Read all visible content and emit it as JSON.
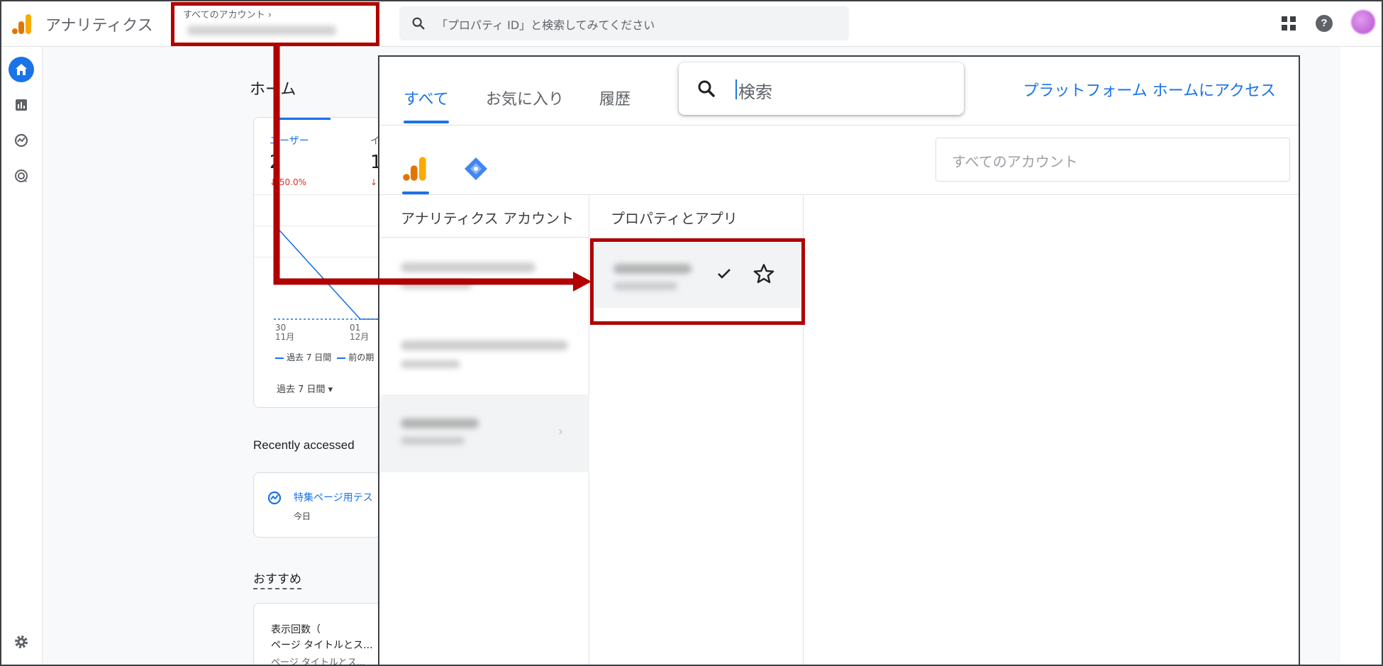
{
  "app": {
    "title": "アナリティクス",
    "account_picker_label": "すべてのアカウント",
    "account_picker_chevron": "›",
    "search_placeholder": "「プロパティ ID」と検索してみてください",
    "help_label": "?"
  },
  "icons": {
    "logo": "analytics-logo-icon",
    "search": "search-icon",
    "apps": "apps-grid-icon",
    "help": "help-icon",
    "home": "home-icon",
    "reports": "reports-icon",
    "explore": "explore-icon",
    "advertising": "advertising-icon",
    "settings": "gear-icon",
    "check": "check-icon",
    "star": "star-outline-icon"
  },
  "main": {
    "page_title": "ホーム",
    "metrics": [
      {
        "label": "ユーザー",
        "value": "2",
        "change": "↓ 50.0%"
      },
      {
        "label": "イ",
        "value": "1",
        "change": "↓"
      }
    ],
    "chart": {
      "x_ticks": [
        {
          "day": "30",
          "month": "11月"
        },
        {
          "day": "01",
          "month": "12月"
        }
      ],
      "legend_current": "過去 7 日間",
      "legend_previous": "前の期"
    },
    "date_range": "過去 7 日間 ▾",
    "recent_title": "Recently accessed",
    "recent_item": {
      "name": "特集ページ用テス",
      "date": "今日"
    },
    "reco_title": "おすすめ",
    "reco_card": {
      "line1": "表示回数（",
      "line2": "ページ タイトルとス...",
      "line3": "ページ タイトルとス..."
    }
  },
  "picker": {
    "tabs": [
      "すべて",
      "お気に入り",
      "履歴"
    ],
    "search_placeholder": "検索",
    "platform_link": "プラットフォーム ホームにアクセス",
    "account_filter_placeholder": "すべてのアカウント",
    "col_accounts": "アナリティクス アカウント",
    "col_properties": "プロパティとアプリ",
    "row_chevron": "›"
  },
  "colors": {
    "accent": "#1a73e8",
    "annotation": "#b00000",
    "negative": "#d93025",
    "ga_orange": "#f9ab00",
    "ga_dark_orange": "#e37400"
  }
}
